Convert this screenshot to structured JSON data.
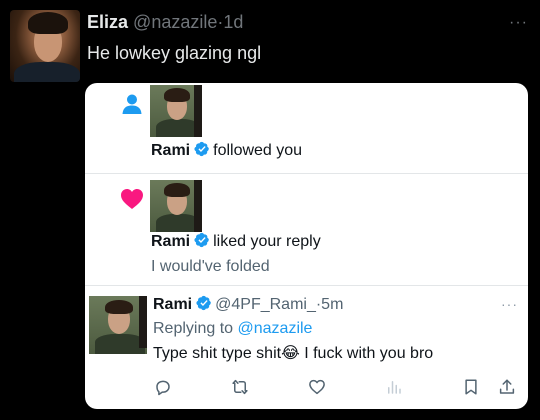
{
  "tweet": {
    "author_name": "Eliza",
    "author_handle": "@nazazile",
    "separator": "·",
    "time": "1d",
    "text": "He lowkey glazing ngl",
    "more": "···"
  },
  "card": {
    "follow": {
      "icon": "person-icon",
      "name": "Rami",
      "action": "followed you"
    },
    "like": {
      "icon": "heart-icon",
      "name": "Rami",
      "action": "liked your reply",
      "quoted": "I would've folded"
    },
    "reply": {
      "name": "Rami",
      "handle": "@4PF_Rami_",
      "separator": "·",
      "time": "5m",
      "replying_prefix": "Replying to",
      "replying_handle": "@nazazile",
      "text_before": "Type shit type shit",
      "emoji": "😂",
      "text_after": "I fuck with you bro",
      "more": "···"
    }
  },
  "colors": {
    "background": "#000000",
    "card": "#ffffff",
    "verified": "#1d9bf0",
    "link": "#1d9bf0",
    "heart": "#f91880",
    "person": "#1d9bf0",
    "muted": "#71767b"
  }
}
